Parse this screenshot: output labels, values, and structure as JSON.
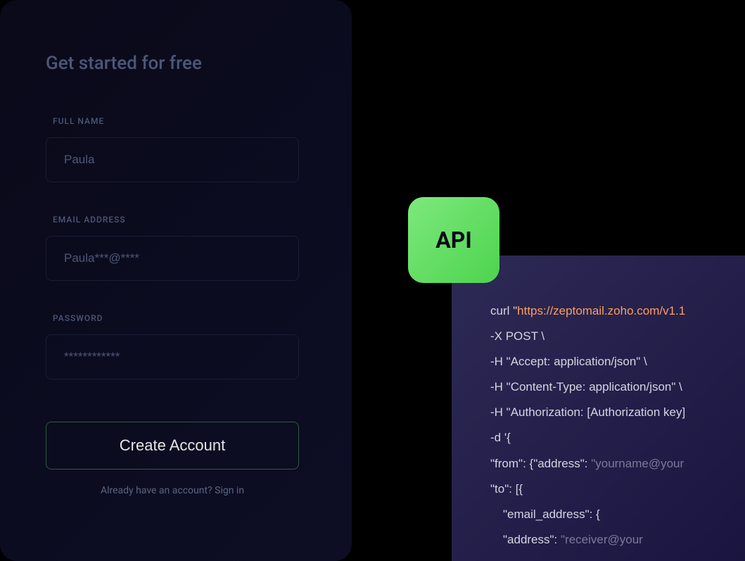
{
  "signup": {
    "title": "Get started for free",
    "fields": {
      "fullname": {
        "label": "FULL NAME",
        "value": "Paula"
      },
      "email": {
        "label": "EMAIL ADDRESS",
        "value": "Paula***@****"
      },
      "password": {
        "label": "PASSWORD",
        "value": "************"
      }
    },
    "button": "Create  Account",
    "signin_text": "Already have an account? Sign in"
  },
  "api_badge": "API",
  "code": {
    "line1_prefix": "curl \"",
    "line1_url": "https://zeptomail.zoho.com/v1.1",
    "line2": "-X POST \\",
    "line3": "-H \"Accept: application/json\" \\",
    "line4": "-H \"Content-Type: application/json\" \\",
    "line5": "-H \"Authorization: [Authorization key]",
    "line6": "-d '{",
    "line7_prefix": "\"from\": {\"address\": ",
    "line7_dim": "\"yourname@your",
    "line8": "\"to\": [{",
    "line9": "\"email_address\": {",
    "line10_prefix": "\"address\": ",
    "line10_dim": "\"receiver@your"
  }
}
